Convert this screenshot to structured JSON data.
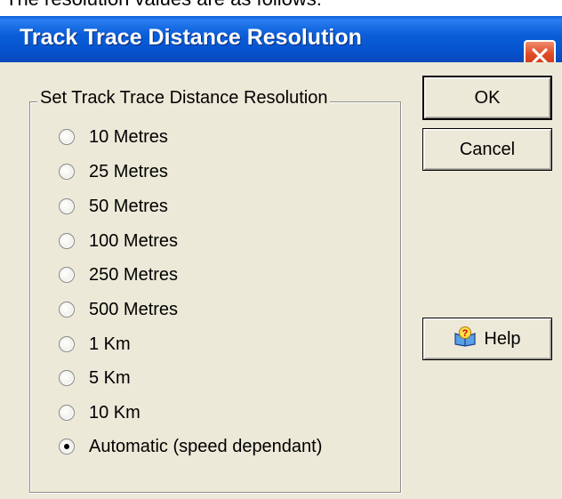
{
  "top_text": "The resolution values are as follows:",
  "window": {
    "title": "Track Trace Distance Resolution"
  },
  "group": {
    "label": "Set Track Trace Distance Resolution",
    "options": [
      {
        "label": "10 Metres",
        "selected": false
      },
      {
        "label": "25 Metres",
        "selected": false
      },
      {
        "label": "50 Metres",
        "selected": false
      },
      {
        "label": "100 Metres",
        "selected": false
      },
      {
        "label": "250 Metres",
        "selected": false
      },
      {
        "label": "500 Metres",
        "selected": false
      },
      {
        "label": "1 Km",
        "selected": false
      },
      {
        "label": "5 Km",
        "selected": false
      },
      {
        "label": "10 Km",
        "selected": false
      },
      {
        "label": "Automatic (speed dependant)",
        "selected": true
      }
    ]
  },
  "buttons": {
    "ok": "OK",
    "cancel": "Cancel",
    "help": "Help"
  },
  "icons": {
    "close": "close-icon",
    "help": "help-book-icon"
  },
  "colors": {
    "titlebar": "#0b5ed9",
    "close_button": "#dd4a24",
    "dialog_bg": "#ece9d8"
  }
}
